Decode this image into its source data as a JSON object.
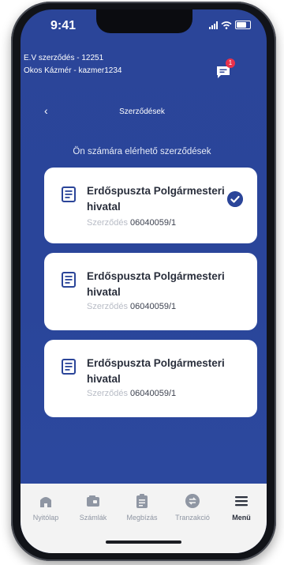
{
  "status_bar": {
    "time": "9:41"
  },
  "header": {
    "contract_line": "E.V szerződés - 12251",
    "user_line": "Okos Kázmér - kazmer1234",
    "message_badge": "1"
  },
  "nav": {
    "back": "‹",
    "title": "Szerződések"
  },
  "section_title": "Ön számára elérhető szerződések",
  "contracts": [
    {
      "name": "Erdőspuszta Polgármesteri hivatal",
      "sub_label": "Szerződés",
      "number": "06040059/1",
      "selected": true
    },
    {
      "name": "Erdőspuszta Polgármesteri hivatal",
      "sub_label": "Szerződés",
      "number": "06040059/1",
      "selected": false
    },
    {
      "name": "Erdőspuszta Polgármesteri hivatal",
      "sub_label": "Szerződés",
      "number": "06040059/1",
      "selected": false
    }
  ],
  "tabbar": [
    {
      "label": "Nyitólap",
      "icon": "home-icon"
    },
    {
      "label": "Számlák",
      "icon": "wallet-icon"
    },
    {
      "label": "Megbízás",
      "icon": "clipboard-icon"
    },
    {
      "label": "Tranzakció",
      "icon": "transfer-icon"
    },
    {
      "label": "Menü",
      "icon": "menu-icon",
      "active": true
    }
  ],
  "colors": {
    "primary": "#2b4599",
    "badge": "#e8314b",
    "card_bg": "#ffffff",
    "tabbar_bg": "#f3f3f3"
  }
}
